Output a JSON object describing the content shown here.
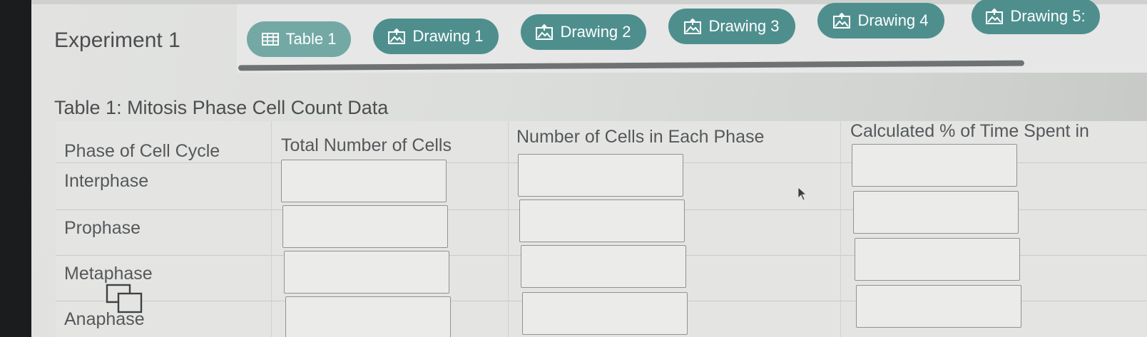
{
  "experiment": {
    "title": "Experiment 1"
  },
  "tabs": [
    {
      "label": "Table 1",
      "icon": "table-icon"
    },
    {
      "label": "Drawing 1",
      "icon": "image-upload-icon"
    },
    {
      "label": "Drawing 2",
      "icon": "image-upload-icon"
    },
    {
      "label": "Drawing 3",
      "icon": "image-upload-icon"
    },
    {
      "label": "Drawing 4",
      "icon": "image-upload-icon"
    },
    {
      "label": "Drawing 5:",
      "icon": "image-upload-icon"
    }
  ],
  "table": {
    "title": "Table 1: Mitosis Phase Cell Count Data",
    "columns": [
      "Phase of Cell Cycle",
      "Total Number of Cells",
      "Number of Cells in Each Phase",
      "Calculated % of Time Spent in"
    ],
    "rows": [
      {
        "phase": "Interphase",
        "total": "",
        "count": "",
        "percent": ""
      },
      {
        "phase": "Prophase",
        "total": "",
        "count": "",
        "percent": ""
      },
      {
        "phase": "Metaphase",
        "total": "",
        "count": "",
        "percent": ""
      },
      {
        "phase": "Anaphase",
        "total": "",
        "count": "",
        "percent": ""
      }
    ]
  },
  "colors": {
    "tab_active": "#73a8a5",
    "tab": "#4e8f8e",
    "text": "#4b4d4f"
  }
}
